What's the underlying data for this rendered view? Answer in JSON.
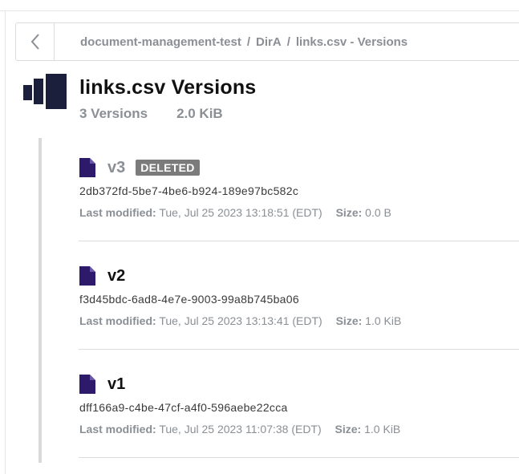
{
  "breadcrumb": {
    "items": [
      "document-management-test",
      "DirA",
      "links.csv - Versions"
    ],
    "separator": "/"
  },
  "header": {
    "title": "links.csv Versions",
    "version_count": "3 Versions",
    "total_size": "2.0 KiB",
    "icon": "bookshelf-icon"
  },
  "versions": [
    {
      "label": "v3",
      "badge": "DELETED",
      "id": "2db372fd-5be7-4be6-b924-189e97bc582c",
      "last_modified_label": "Last modified:",
      "last_modified": "Tue, Jul 25 2023 13:18:51 (EDT)",
      "size_label": "Size:",
      "size": "0.0 B"
    },
    {
      "label": "v2",
      "id": "f3d45bdc-6ad8-4e7e-9003-99a8b745ba06",
      "last_modified_label": "Last modified:",
      "last_modified": "Tue, Jul 25 2023 13:13:41 (EDT)",
      "size_label": "Size:",
      "size": "1.0 KiB"
    },
    {
      "label": "v1",
      "id": "dff166a9-c4be-47cf-a4f0-596aebe22cca",
      "last_modified_label": "Last modified:",
      "last_modified": "Tue, Jul 25 2023 11:07:38 (EDT)",
      "size_label": "Size:",
      "size": "1.0 KiB"
    }
  ],
  "colors": {
    "accent_dark": "#1b1f3b",
    "file_icon": "#2e1a6b",
    "muted_text": "#8a8f95",
    "badge_bg": "#7b7b7b"
  }
}
